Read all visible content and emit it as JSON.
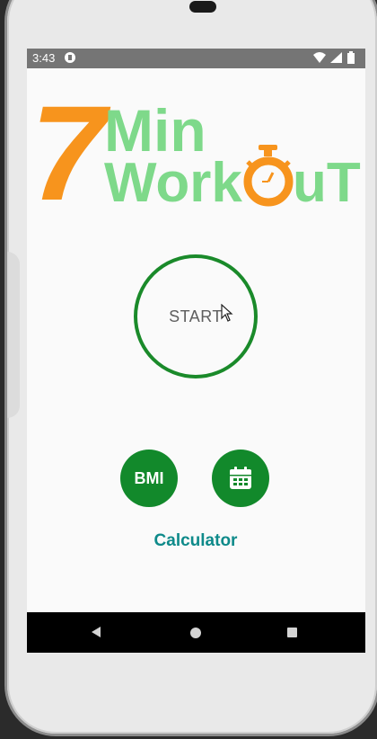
{
  "status_bar": {
    "time": "3:43"
  },
  "logo": {
    "number": "7",
    "word_top": "Min",
    "word_bottom_a": "Work",
    "word_bottom_b": "uT",
    "colors": {
      "number": "#f7941d",
      "words": "#7ed98a",
      "stopwatch": "#f7941d"
    }
  },
  "start_button": {
    "label": "START"
  },
  "bmi_button": {
    "label": "BMI"
  },
  "history_button": {
    "icon": "calendar-icon"
  },
  "calculator_label": "Calculator",
  "navigation_bar": {
    "icons": [
      "back-icon",
      "home-icon",
      "recents-icon"
    ]
  },
  "colors": {
    "accent_green": "#12892b",
    "teal_text": "#0e8a8a",
    "status_bar": "#757575"
  }
}
